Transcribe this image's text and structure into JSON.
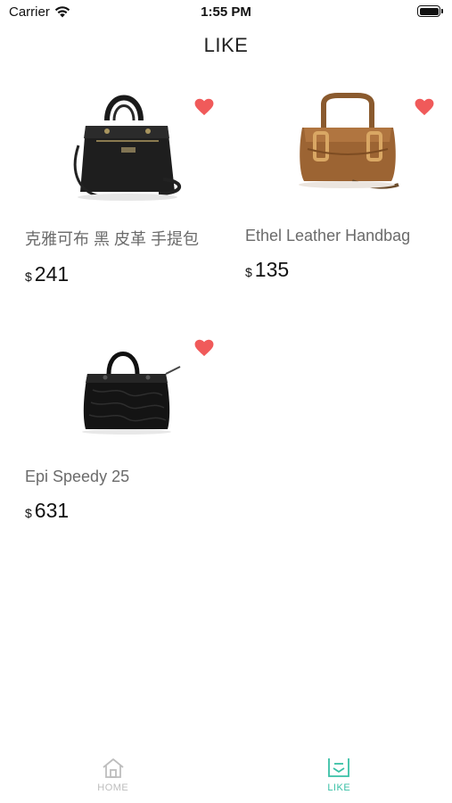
{
  "status_bar": {
    "carrier": "Carrier",
    "time": "1:55 PM"
  },
  "header": {
    "title": "LIKE"
  },
  "products": [
    {
      "name": "克雅可布 黑 皮革 手提包",
      "currency": "$",
      "price": "241",
      "liked": true,
      "image": "black-structured-handbag"
    },
    {
      "name": "Ethel Leather Handbag",
      "currency": "$",
      "price": "135",
      "liked": true,
      "image": "brown-leather-handbag"
    },
    {
      "name": "Epi Speedy 25",
      "currency": "$",
      "price": "631",
      "liked": true,
      "image": "black-speedy-bag"
    }
  ],
  "tab_bar": {
    "items": [
      {
        "label": "HOME",
        "icon": "home-icon",
        "active": false
      },
      {
        "label": "LIKE",
        "icon": "like-list-icon",
        "active": true
      }
    ]
  },
  "colors": {
    "heart": "#f05a5a",
    "active_tab": "#39c0a6",
    "inactive_tab": "#bdbdbd"
  }
}
